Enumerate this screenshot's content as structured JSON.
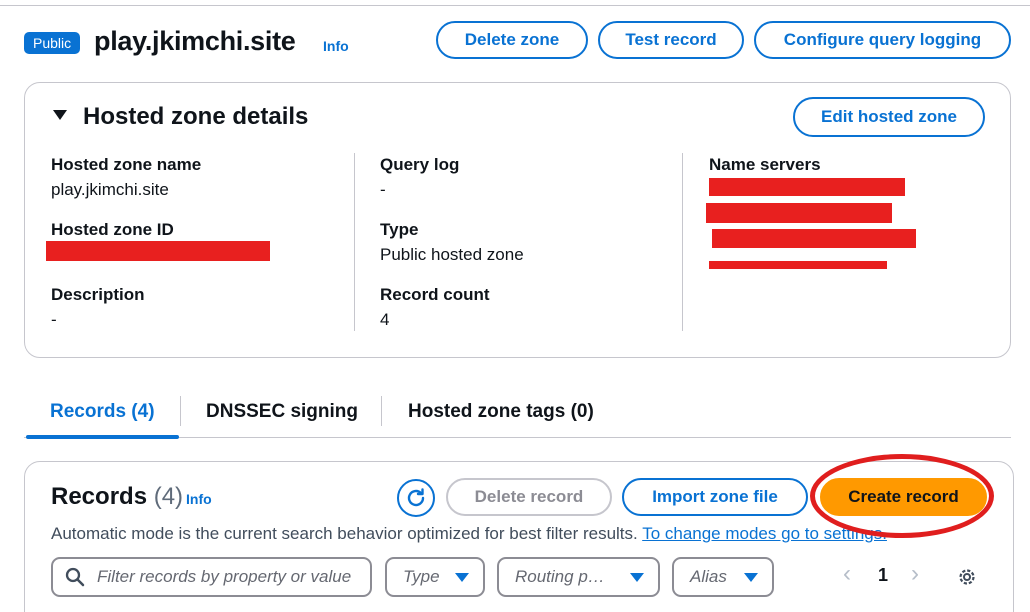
{
  "header": {
    "badge": "Public",
    "title": "play.jkimchi.site",
    "info": "Info",
    "buttons": {
      "delete_zone": "Delete zone",
      "test_record": "Test record",
      "configure_logging": "Configure query logging"
    }
  },
  "details": {
    "title": "Hosted zone details",
    "edit_button": "Edit hosted zone",
    "fields": {
      "zone_name_label": "Hosted zone name",
      "zone_name_value": "play.jkimchi.site",
      "zone_id_label": "Hosted zone ID",
      "description_label": "Description",
      "description_value": "-",
      "query_log_label": "Query log",
      "query_log_value": "-",
      "type_label": "Type",
      "type_value": "Public hosted zone",
      "record_count_label": "Record count",
      "record_count_value": "4",
      "name_servers_label": "Name servers"
    }
  },
  "tabs": {
    "records": "Records (4)",
    "dnssec": "DNSSEC signing",
    "tags": "Hosted zone tags (0)"
  },
  "records": {
    "title": "Records",
    "count": "(4)",
    "info": "Info",
    "delete_button": "Delete record",
    "import_button": "Import zone file",
    "create_button": "Create record",
    "hint_text": "Automatic mode is the current search behavior optimized for best filter results.",
    "hint_link": "To change modes go to settings.",
    "search_placeholder": "Filter records by property or value",
    "filters": {
      "type": "Type",
      "routing": "Routing p…",
      "alias": "Alias"
    },
    "pagination": {
      "prev": "‹",
      "page": "1",
      "next": "›"
    }
  },
  "colors": {
    "accent": "#0972d3",
    "primary_button": "#ff9900",
    "redaction": "#e8201f",
    "highlight_circle": "#e01e1e"
  }
}
